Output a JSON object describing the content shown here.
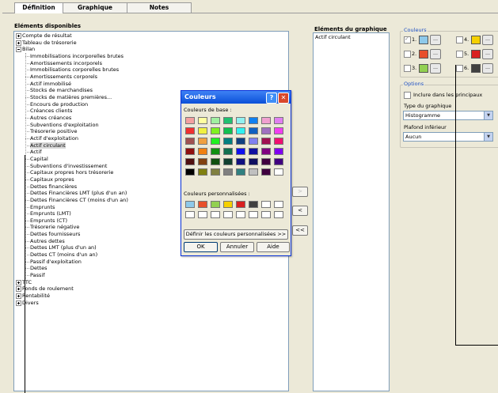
{
  "tabs": [
    "Définition",
    "Graphique",
    "Notes"
  ],
  "left": {
    "title": "Eléments disponibles",
    "tree": [
      {
        "label": "Compte de résultat",
        "level": 0,
        "expander": "plus"
      },
      {
        "label": "Tableau de trésorerie",
        "level": 0,
        "expander": "plus"
      },
      {
        "label": "Bilan",
        "level": 0,
        "expander": "minus"
      },
      {
        "label": "Immobilisations incorporelles brutes",
        "level": 1
      },
      {
        "label": "Amortissements incorporels",
        "level": 1
      },
      {
        "label": "Immobilisations corporelles brutes",
        "level": 1
      },
      {
        "label": "Amortissements corporels",
        "level": 1
      },
      {
        "label": "Actif immobilisé",
        "level": 1
      },
      {
        "label": "Stocks de marchandises",
        "level": 1
      },
      {
        "label": "Stocks de matières premières...",
        "level": 1
      },
      {
        "label": "Encours de production",
        "level": 1
      },
      {
        "label": "Créances clients",
        "level": 1
      },
      {
        "label": "Autres créances",
        "level": 1
      },
      {
        "label": "Subventions d'exploitation",
        "level": 1
      },
      {
        "label": "Trésorerie positive",
        "level": 1
      },
      {
        "label": "Actif d'exploitation",
        "level": 1
      },
      {
        "label": "Actif circulant",
        "level": 1,
        "selected": true
      },
      {
        "label": "Actif",
        "level": 1
      },
      {
        "label": "Capital",
        "level": 1
      },
      {
        "label": "Subventions d'investissement",
        "level": 1
      },
      {
        "label": "Capitaux propres hors trésorerie",
        "level": 1
      },
      {
        "label": "Capitaux propres",
        "level": 1
      },
      {
        "label": "Dettes financières",
        "level": 1
      },
      {
        "label": "Dettes Financières LMT (plus d'un an)",
        "level": 1
      },
      {
        "label": "Dettes Financières CT (moins d'un an)",
        "level": 1
      },
      {
        "label": "Emprunts",
        "level": 1
      },
      {
        "label": "Emprunts (LMT)",
        "level": 1
      },
      {
        "label": "Emprunts (CT)",
        "level": 1
      },
      {
        "label": "Trésorerie négative",
        "level": 1
      },
      {
        "label": "Dettes fournisseurs",
        "level": 1
      },
      {
        "label": "Autres dettes",
        "level": 1
      },
      {
        "label": "Dettes LMT (plus d'un an)",
        "level": 1
      },
      {
        "label": "Dettes CT (moins d'un an)",
        "level": 1
      },
      {
        "label": "Passif d'exploitation",
        "level": 1
      },
      {
        "label": "Dettes",
        "level": 1
      },
      {
        "label": "Passif",
        "level": 1
      },
      {
        "label": "TTC",
        "level": 0,
        "expander": "plus"
      },
      {
        "label": "Fonds de roulement",
        "level": 0,
        "expander": "plus"
      },
      {
        "label": "Rentabilité",
        "level": 0,
        "expander": "plus"
      },
      {
        "label": "Divers",
        "level": 0,
        "expander": "plus"
      }
    ]
  },
  "middle": {
    "buttons": [
      ">",
      "<",
      "<<"
    ],
    "title": "Eléments du graphique",
    "items": [
      "Actif circulant"
    ]
  },
  "right": {
    "colors_group": "Couleurs",
    "color_slots": [
      {
        "num": "1.",
        "color": "#8ec9ea",
        "checked": true
      },
      {
        "num": "2.",
        "color": "#e8502a",
        "checked": false
      },
      {
        "num": "3.",
        "color": "#92d050",
        "checked": false
      },
      {
        "num": "4.",
        "color": "#f5d000",
        "checked": false
      },
      {
        "num": "5.",
        "color": "#d92020",
        "checked": false
      },
      {
        "num": "6.",
        "color": "#404040",
        "checked": false
      }
    ],
    "options_group": "Options",
    "include_label": "Inclure dans les principaux",
    "chart_type_label": "Type du graphique",
    "chart_type_value": "Histogramme",
    "floor_label": "Plafond inférieur",
    "floor_value": "Aucun"
  },
  "dialog": {
    "title": "Couleurs",
    "base_label": "Couleurs de base :",
    "base_colors": [
      [
        "#f4a0a0",
        "#ffffa0",
        "#a0f0a0",
        "#20c070",
        "#90f0f0",
        "#1080f0",
        "#f0a0d0",
        "#e080f0"
      ],
      [
        "#f03030",
        "#f0f040",
        "#80f020",
        "#10c050",
        "#30f0f0",
        "#1060c0",
        "#a070c0",
        "#f040f0"
      ],
      [
        "#a05050",
        "#f0a040",
        "#20f020",
        "#008080",
        "#104080",
        "#8080f0",
        "#a01050",
        "#f01070"
      ],
      [
        "#901010",
        "#f08010",
        "#109010",
        "#107050",
        "#1010f0",
        "#1010a0",
        "#800080",
        "#8000f0"
      ],
      [
        "#501010",
        "#804010",
        "#105010",
        "#104030",
        "#101080",
        "#101060",
        "#400040",
        "#400080"
      ],
      [
        "#000000",
        "#808010",
        "#808040",
        "#808080",
        "#308080",
        "#c0c0c0",
        "#400040",
        "#ffffff"
      ]
    ],
    "custom_label": "Couleurs personnalisées :",
    "custom_colors": [
      [
        "#8ec9ea",
        "#e8502a",
        "#92d050",
        "#f5d000",
        "#d92020",
        "#404040",
        "#ffffff",
        "#ffffff"
      ],
      [
        "#ffffff",
        "#ffffff",
        "#ffffff",
        "#ffffff",
        "#ffffff",
        "#ffffff",
        "#ffffff",
        "#ffffff"
      ]
    ],
    "define_button": "Définir les couleurs personnalisées >>",
    "ok": "OK",
    "cancel": "Annuler",
    "help": "Aide",
    "help_icon": "?",
    "close_icon": "✕"
  }
}
